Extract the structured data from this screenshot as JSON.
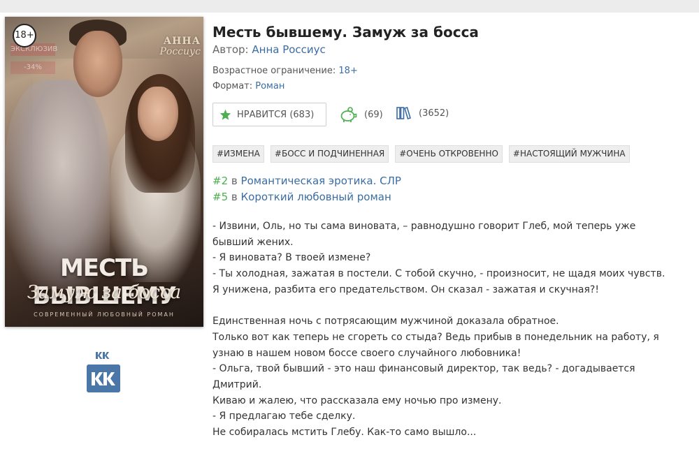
{
  "cover": {
    "age_badge": "18+",
    "exclusive_label": "ЭКСКЛЮЗИВ",
    "discount_label": "-34%",
    "author_first": "АННА",
    "author_last": "Россиус",
    "title_line1": "МЕСТЬ БЫВШЕМУ",
    "title_line2": "Замуж за босса",
    "genre_line": "СОВРЕМЕННЫЙ ЛЮБОВНЫЙ РОМАН"
  },
  "book": {
    "title": "Месть бывшему. Замуж за босса",
    "author_label": "Автор:",
    "author_name": "Анна Россиус",
    "age_label": "Возрастное ограничение:",
    "age_value": "18+",
    "format_label": "Формат:",
    "format_value": "Роман"
  },
  "stats": {
    "like_label": "НРАВИТСЯ (683)",
    "rewards": "(69)",
    "library": "(3652)"
  },
  "tags": [
    "#ИЗМЕНА",
    "#БОСС И ПОДЧИНЕННАЯ",
    "#ОЧЕНЬ ОТКРОВЕННО",
    "#НАСТОЯЩИЙ МУЖЧИНА"
  ],
  "rankings": [
    {
      "num": "#2",
      "word": "в",
      "category": "Романтическая эротика. СЛР"
    },
    {
      "num": "#5",
      "word": "в",
      "category": "Короткий любовный роман"
    }
  ],
  "description": [
    "- Извини, Оль, но ты сама виновата, – равнодушно говорит Глеб, мой теперь уже",
    "бывший жених.",
    "- Я виновата? В твоей измене?",
    "- Ты холодная, зажатая в постели. С тобой скучно, - произносит, не щадя моих чувств.",
    "Я унижена, разбита его предательством. Он сказал - зажатая и скучная?!",
    "",
    "Единственная ночь с потрясающим мужчиной доказала обратное.",
    "Только вот как теперь не сгореть со стыда? Ведь прибыв в понедельник на работу, я",
    "узнаю в нашем новом боссе своего случайного любовника!",
    "- Ольга, твой бывший - это наш финансовый директор, так ведь? - догадывается",
    "Дмитрий.",
    "Киваю и жалею, что рассказала ему ночью про измену.",
    "- Я предлагаю тебе сделку.",
    "Не собиралась мстить Глебу. Как-то само вышло..."
  ],
  "colors": {
    "link": "#3b6da3",
    "rank_number": "#4caf50",
    "vk": "#4a76a8"
  }
}
